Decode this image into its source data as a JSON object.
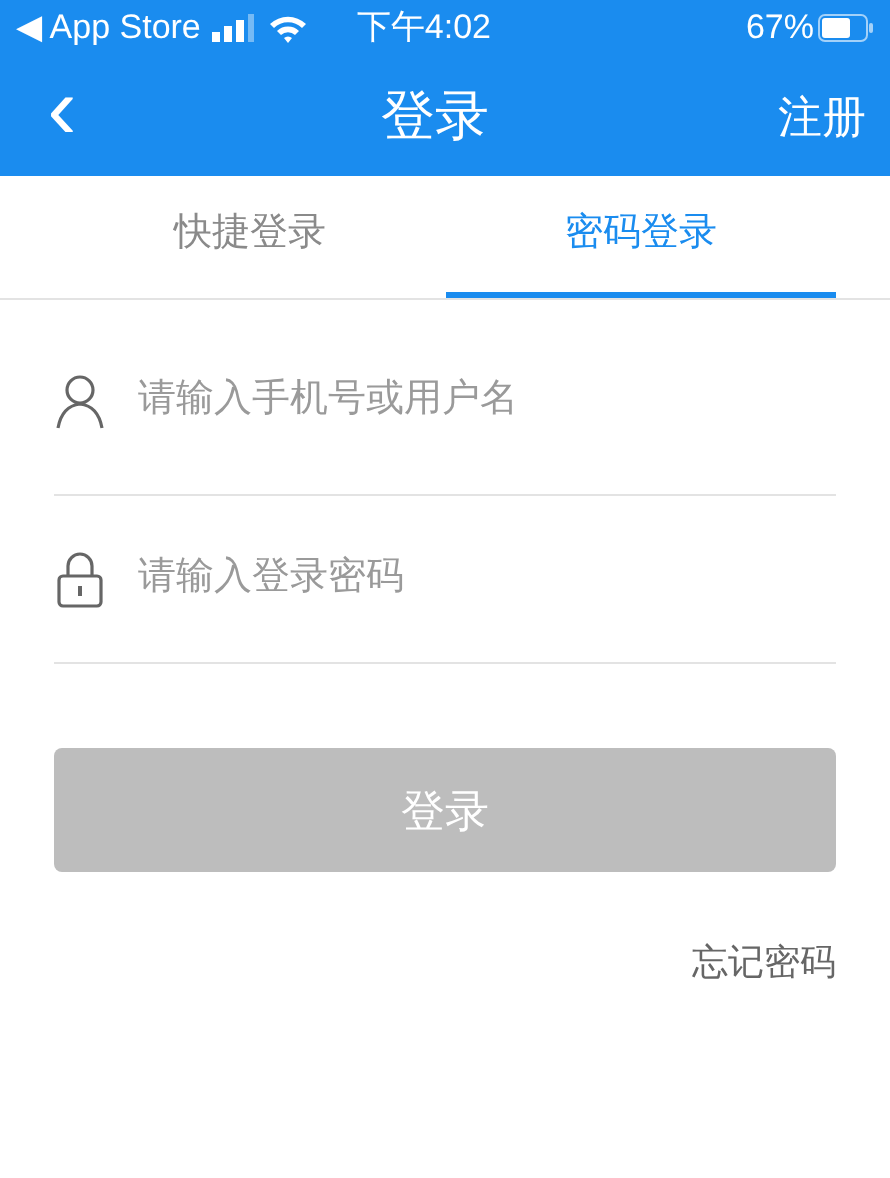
{
  "status_bar": {
    "back_app": "◀ App Store",
    "time": "下午4:02",
    "battery": "67%"
  },
  "nav_bar": {
    "back": "‹",
    "title": "登录",
    "action": "注册"
  },
  "tabs": [
    {
      "label": "快捷登录",
      "selected": false
    },
    {
      "label": "密码登录",
      "selected": true
    }
  ],
  "fields": [
    {
      "kind": "user",
      "placeholder": "请输入手机号或用户名"
    },
    {
      "kind": "lock",
      "placeholder": "请输入登录密码"
    }
  ],
  "login_button": {
    "label": "登录",
    "disabled": true
  },
  "forgot_link": "忘记密码"
}
